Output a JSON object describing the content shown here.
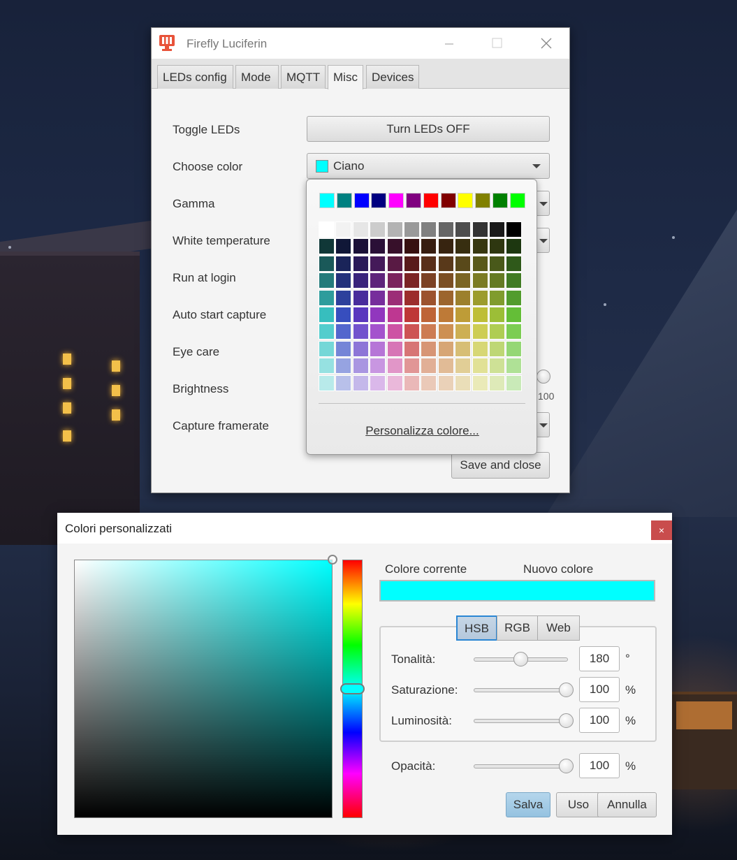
{
  "window": {
    "title": "Firefly Luciferin",
    "tabs": [
      "LEDs config",
      "Mode",
      "MQTT",
      "Misc",
      "Devices"
    ],
    "active_tab": "Misc"
  },
  "misc": {
    "labels": {
      "toggle_leds": "Toggle LEDs",
      "choose_color": "Choose color",
      "gamma": "Gamma",
      "white_temperature": "White temperature",
      "run_at_login": "Run at login",
      "auto_start_capture": "Auto start capture",
      "eye_care": "Eye care",
      "brightness": "Brightness",
      "capture_framerate": "Capture framerate"
    },
    "toggle_button": "Turn LEDs OFF",
    "color_combo": {
      "value": "Ciano",
      "swatch": "#00ffff"
    },
    "brightness_tick_partial": "100",
    "save_button": "Save and close"
  },
  "palette": {
    "top_row": [
      "#00ffff",
      "#008080",
      "#0000ff",
      "#000080",
      "#ff00ff",
      "#800080",
      "#ff0000",
      "#800000",
      "#ffff00",
      "#808000",
      "#008000",
      "#00ff00"
    ],
    "grays": [
      "#ffffff",
      "#f2f2f2",
      "#e6e6e6",
      "#cccccc",
      "#b3b3b3",
      "#999999",
      "#808080",
      "#666666",
      "#4d4d4d",
      "#333333",
      "#1a1a1a",
      "#000000"
    ],
    "custom_link": "Personalizza colore..."
  },
  "dialog": {
    "title": "Colori personalizzati",
    "close": "×",
    "current_color_label": "Colore corrente",
    "new_color_label": "Nuovo colore",
    "preview_color": "#00ffff",
    "modes": [
      "HSB",
      "RGB",
      "Web"
    ],
    "selected_mode": "HSB",
    "fields": [
      {
        "label": "Tonalità:",
        "value": "180",
        "unit": "°",
        "fraction": 0.5
      },
      {
        "label": "Saturazione:",
        "value": "100",
        "unit": "%",
        "fraction": 1.0
      },
      {
        "label": "Luminosità:",
        "value": "100",
        "unit": "%",
        "fraction": 1.0
      }
    ],
    "opacity": {
      "label": "Opacità:",
      "value": "100",
      "unit": "%",
      "fraction": 1.0
    },
    "buttons": {
      "save": "Salva",
      "use": "Uso",
      "cancel": "Annulla"
    }
  }
}
